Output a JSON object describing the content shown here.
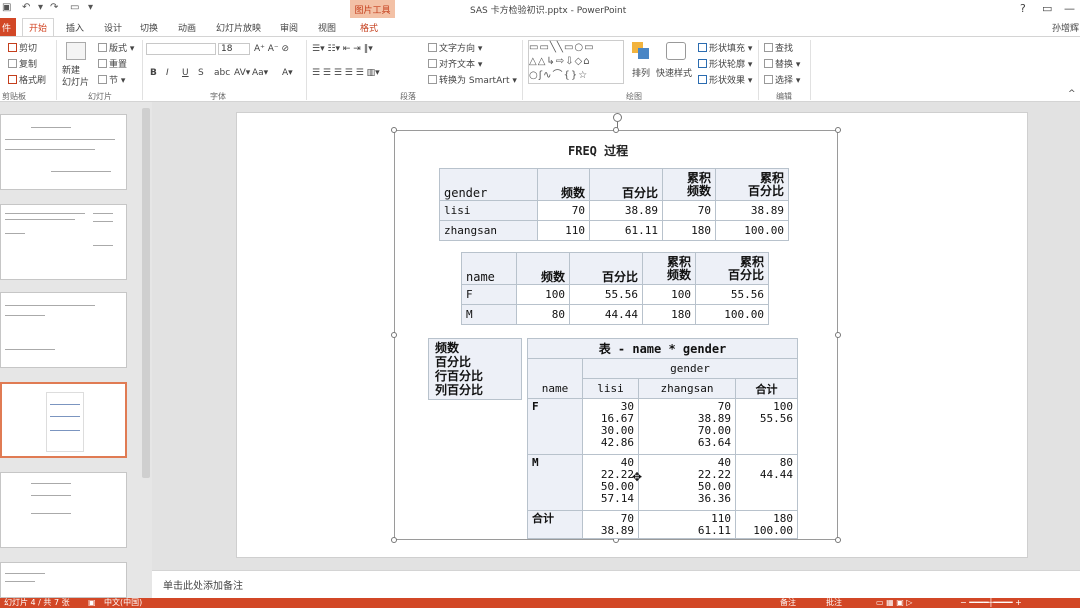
{
  "window": {
    "title": "SAS 卡方检验初识.pptx - PowerPoint",
    "context_tab": "图片工具",
    "user": "孙增辉",
    "help": "?"
  },
  "tabs": [
    "开始",
    "插入",
    "设计",
    "切换",
    "动画",
    "幻灯片放映",
    "审阅",
    "视图",
    "格式"
  ],
  "file_tab": "件",
  "ribbon": {
    "clipboard": {
      "cut": "剪切",
      "copy": "复制",
      "format_painter": "格式刷",
      "group": "剪贴板"
    },
    "slides": {
      "new_slide": "新建",
      "new_slide2": "幻灯片",
      "layout": "版式",
      "reset": "重置",
      "section": "节",
      "group": "幻灯片"
    },
    "font": {
      "size": "18",
      "group": "字体"
    },
    "paragraph": {
      "text_direction": "文字方向",
      "align_text": "对齐文本",
      "smartart": "转换为 SmartArt",
      "group": "段落"
    },
    "drawing": {
      "arrange": "排列",
      "quick_styles": "快速样式",
      "shape_fill": "形状填充",
      "shape_outline": "形状轮廓",
      "shape_effects": "形状效果",
      "group": "绘图"
    },
    "editing": {
      "find": "查找",
      "replace": "替换",
      "select": "选择",
      "group": "编辑"
    }
  },
  "slide": {
    "title": "FREQ 过程",
    "table1": {
      "headers": [
        "gender",
        "频数",
        "百分比",
        "累积\n频数",
        "累积\n百分比"
      ],
      "rows": [
        [
          "lisi",
          "70",
          "38.89",
          "70",
          "38.89"
        ],
        [
          "zhangsan",
          "110",
          "61.11",
          "180",
          "100.00"
        ]
      ]
    },
    "table2": {
      "headers": [
        "name",
        "频数",
        "百分比",
        "累积\n频数",
        "累积\n百分比"
      ],
      "rows": [
        [
          "F",
          "100",
          "55.56",
          "100",
          "55.56"
        ],
        [
          "M",
          "80",
          "44.44",
          "180",
          "100.00"
        ]
      ]
    },
    "key_box": "频数\n百分比\n行百分比\n列百分比",
    "table3": {
      "title": "表 - name * gender",
      "col_group": "gender",
      "headers": [
        "name",
        "lisi",
        "zhangsan",
        "合计"
      ],
      "rows": [
        [
          "F",
          "30\n16.67\n30.00\n42.86",
          "70\n38.89\n70.00\n63.64",
          "100\n55.56"
        ],
        [
          "M",
          "40\n22.22\n50.00\n57.14",
          "40\n22.22\n50.00\n36.36",
          "80\n44.44"
        ],
        [
          "合计",
          "70\n38.89",
          "110\n61.11",
          "180\n100.00"
        ]
      ]
    }
  },
  "notes": {
    "placeholder": "单击此处添加备注"
  },
  "status": {
    "slide_info": "幻灯片 4 / 共 7 张",
    "language": "中文(中国)",
    "notes": "备注",
    "comments": "批注"
  }
}
